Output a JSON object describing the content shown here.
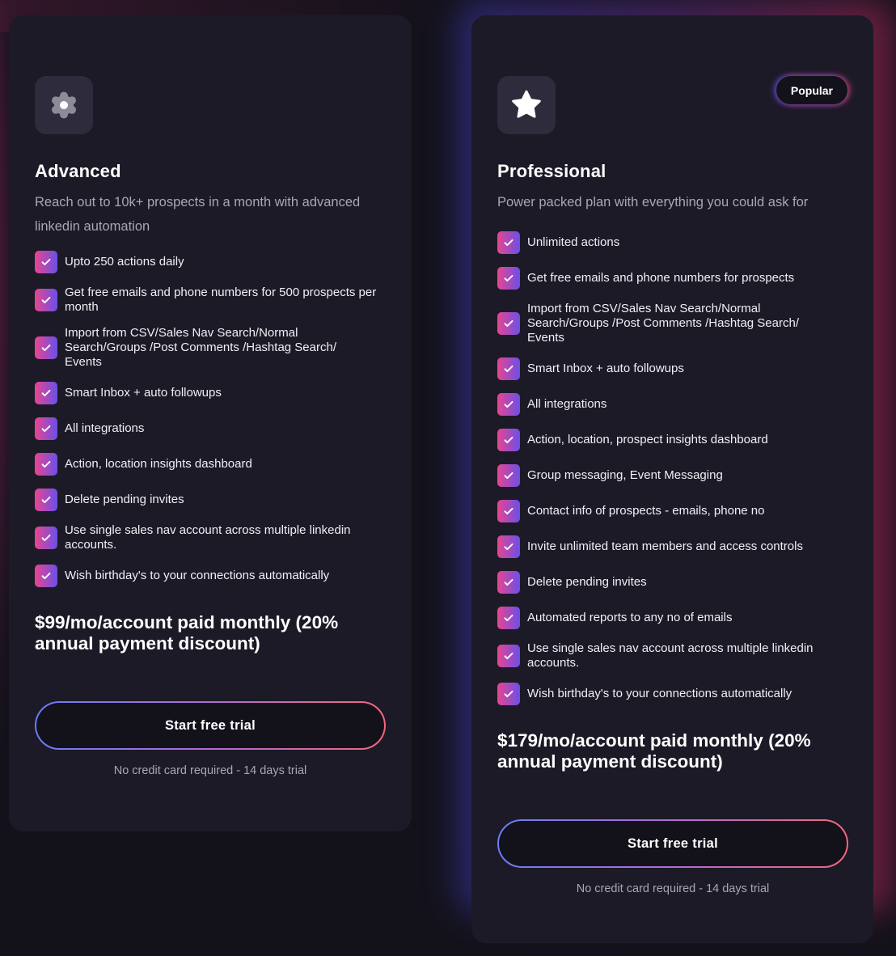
{
  "colors": {
    "background": "#13121b",
    "card": "#1c1a26",
    "check_gradient_start": "#e8458f",
    "check_gradient_end": "#6a50e8",
    "cta_border_start": "#6b7cf5",
    "cta_border_end": "#f0687c",
    "muted_text": "#a9a6b5"
  },
  "plans": [
    {
      "icon": "gear-icon",
      "title": "Advanced",
      "description": "Reach out to 10k+ prospects in a month with advanced linkedin automation",
      "features": [
        "Upto 250 actions daily",
        "Get free emails and phone numbers for 500 prospects per month",
        "Import from CSV/Sales Nav Search/Normal\n Search/Groups /Post Comments /Hashtag Search/\nEvents",
        "Smart Inbox + auto followups",
        "All integrations",
        "Action, location insights dashboard",
        "Delete pending invites",
        "Use single sales nav account across multiple linkedin accounts.",
        "Wish birthday's to your connections automatically"
      ],
      "price": "$99/mo/account paid monthly (20% annual payment discount)",
      "cta_label": "Start free trial",
      "note": "No credit card required - 14 days trial"
    },
    {
      "icon": "star-icon",
      "badge": "Popular",
      "title": "Professional",
      "description": "Power packed plan with everything you could ask for",
      "features": [
        "Unlimited actions",
        "Get free emails and phone numbers for prospects",
        "Import from CSV/Sales Nav Search/Normal\n Search/Groups /Post Comments /Hashtag Search/\nEvents",
        "Smart Inbox + auto followups",
        "All integrations",
        "Action, location, prospect insights dashboard",
        "Group messaging, Event Messaging",
        "Contact info of prospects - emails, phone no",
        "Invite unlimited team members and access controls",
        "Delete pending invites",
        "Automated reports to any no of emails",
        "Use single sales nav account across multiple linkedin accounts.",
        "Wish birthday's to your connections automatically"
      ],
      "price": "$179/mo/account paid monthly (20% annual payment discount)",
      "cta_label": "Start free trial",
      "note": "No credit card required - 14 days trial"
    }
  ]
}
